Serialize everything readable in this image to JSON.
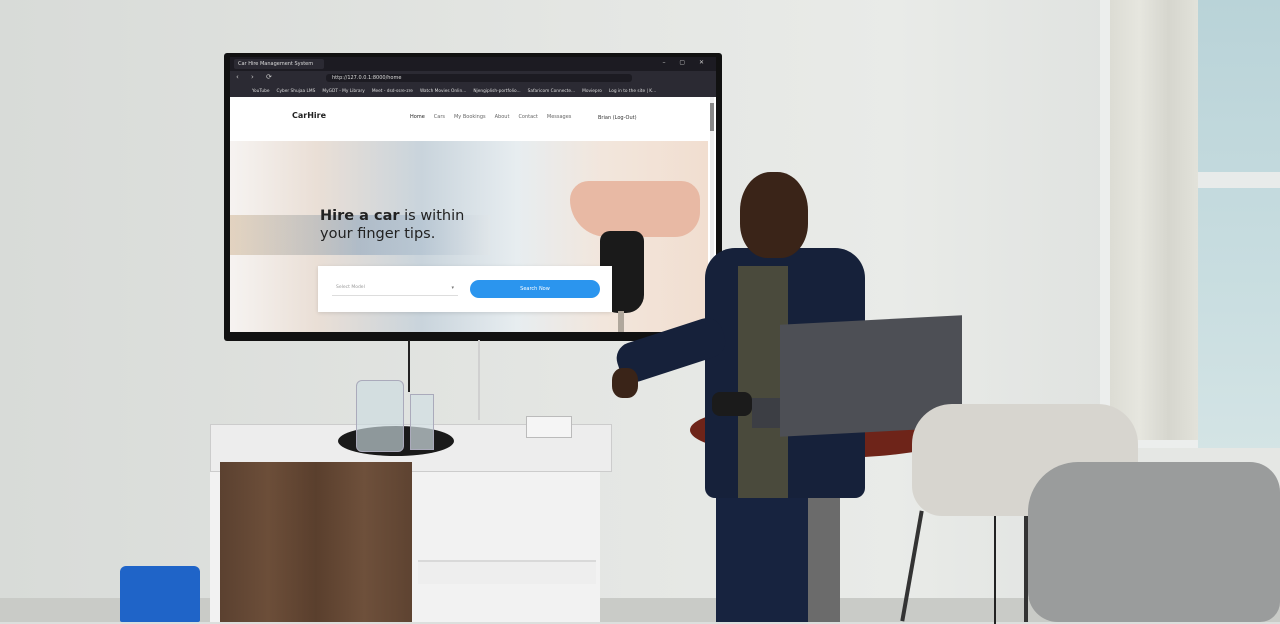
{
  "browser": {
    "tab_title": "Car Hire Management System",
    "url": "http://127.0.0.1:8000/home",
    "window_controls": "– ▢ ✕",
    "nav_glyphs": "‹ › ⟳",
    "bookmarks": [
      "YouTube",
      "Cyber Shujaa LMS",
      "MyGDT - My Library",
      "Meet - dsd-ssre-zre",
      "Watch Movies Onlin...",
      "Njengiplish-portfolio...",
      "Safaricom Connecte...",
      "Moviepro",
      "Log in to the site | K..."
    ]
  },
  "site": {
    "brand": "CarHire",
    "nav": [
      "Home",
      "Cars",
      "My Bookings",
      "About",
      "Contact",
      "Messages"
    ],
    "user": "Brian (Log-Out)",
    "hero": {
      "headline_bold": "Hire a car",
      "headline_rest_1": " is within",
      "headline_rest_2": "your finger tips."
    },
    "search": {
      "select_placeholder": "Select Model",
      "chevron": "▾",
      "button_label": "Search Now"
    }
  },
  "colors": {
    "accent_button": "#2b95ee",
    "table_top": "#6e2419",
    "bin": "#1f64c8"
  }
}
